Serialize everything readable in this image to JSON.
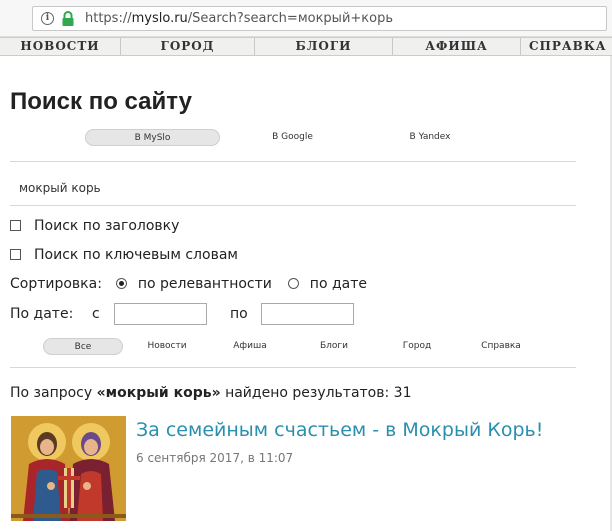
{
  "browser": {
    "url_prefix": "https://",
    "url_domain": "myslo.ru",
    "url_path": "/Search?search=мокрый+корь"
  },
  "nav": {
    "items": [
      {
        "label": "НОВОСТИ"
      },
      {
        "label": "ГОРОД"
      },
      {
        "label": "БЛОГИ"
      },
      {
        "label": "АФИША"
      },
      {
        "label": "СПРАВКА"
      }
    ]
  },
  "page": {
    "title": "Поиск по сайту"
  },
  "engines": {
    "items": [
      {
        "label": "В MySlo",
        "active": true
      },
      {
        "label": "В Google",
        "active": false
      },
      {
        "label": "В Yandex",
        "active": false
      }
    ]
  },
  "search": {
    "query": "мокрый корь"
  },
  "options": {
    "by_title_label": "Поиск по заголовку",
    "by_keywords_label": "Поиск по ключевым словам",
    "sort_label": "Сортировка:",
    "sort_relevance_label": "по релевантности",
    "sort_date_label": "по дате",
    "sort_selected": "relevance",
    "date_label": "По дате:",
    "date_from_label": "с",
    "date_to_label": "по"
  },
  "categories": {
    "items": [
      {
        "label": "Все",
        "active": true
      },
      {
        "label": "Новости",
        "active": false
      },
      {
        "label": "Афиша",
        "active": false
      },
      {
        "label": "Блоги",
        "active": false
      },
      {
        "label": "Город",
        "active": false
      },
      {
        "label": "Справка",
        "active": false
      }
    ]
  },
  "results": {
    "prefix": "По запросу ",
    "query_quoted": "«мокрый корь»",
    "suffix": " найдено результатов: 31",
    "items": [
      {
        "title": "За семейным счастьем - в Мокрый Корь!",
        "date": "6 сентября 2017, в 11:07",
        "thumbnail": "icon-saints-image"
      }
    ]
  },
  "colors": {
    "link": "#2a8fae",
    "lock": "#2fa84f",
    "nav_bg": "#f0f0ef"
  }
}
